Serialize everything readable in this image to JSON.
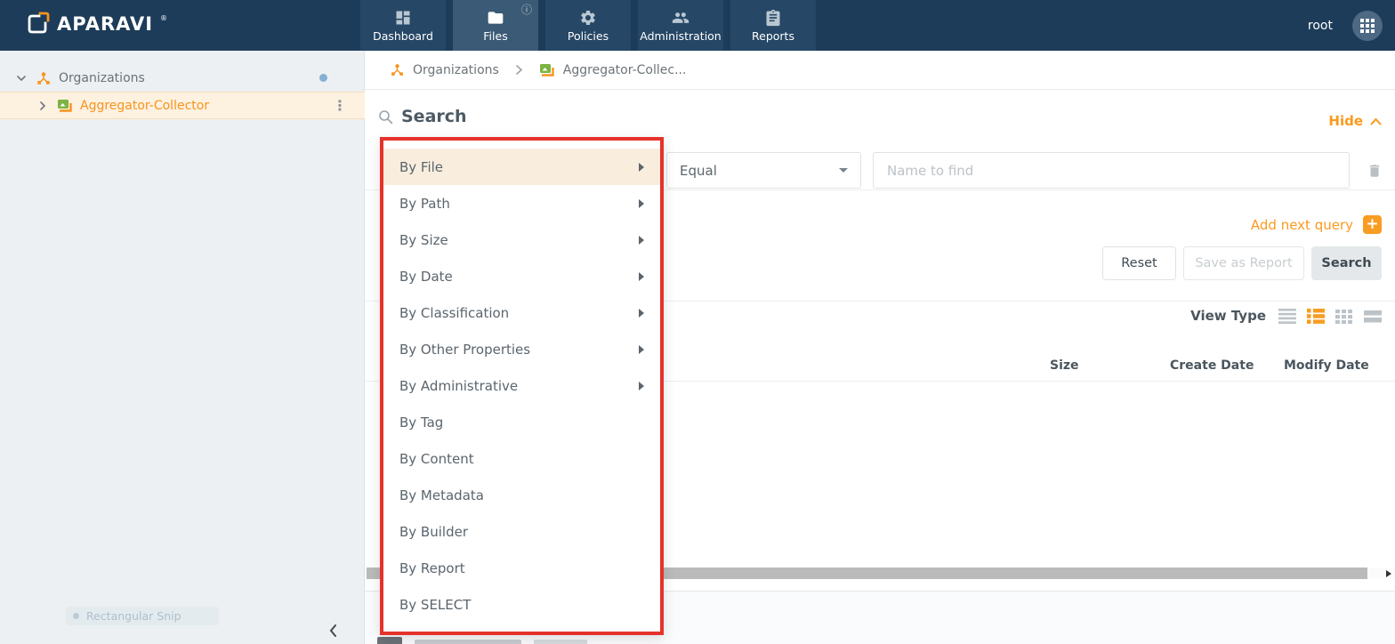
{
  "navbar": {
    "brand": "APARAVI",
    "brand_mark": "®",
    "user": "root",
    "tabs": [
      {
        "label": "Dashboard",
        "icon": "dashboard-icon"
      },
      {
        "label": "Files",
        "icon": "folder-icon"
      },
      {
        "label": "Policies",
        "icon": "gear-icon"
      },
      {
        "label": "Administration",
        "icon": "people-icon"
      },
      {
        "label": "Reports",
        "icon": "clipboard-icon"
      }
    ],
    "active_tab": "Files"
  },
  "sidebar": {
    "root_item": {
      "label": "Organizations",
      "expanded": true
    },
    "child_item": {
      "label": "Aggregator-Collector",
      "selected": true
    },
    "snip_ghost": "Rectangular Snip"
  },
  "breadcrumb": {
    "items": [
      {
        "label": "Organizations",
        "icon": "organizations-icon"
      },
      {
        "label": "Aggregator-Collec...",
        "icon": "collector-icon"
      }
    ]
  },
  "search_panel": {
    "title": "Search",
    "hide_label": "Hide",
    "operator_value": "Equal",
    "name_placeholder": "Name to find",
    "add_next_query_label": "Add next query",
    "plus_label": "+",
    "reset_label": "Reset",
    "save_as_report_label": "Save as Report",
    "search_label": "Search"
  },
  "field_menu": {
    "items": [
      {
        "label": "By File",
        "has_submenu": true,
        "highlighted": true
      },
      {
        "label": "By Path",
        "has_submenu": true
      },
      {
        "label": "By Size",
        "has_submenu": true
      },
      {
        "label": "By Date",
        "has_submenu": true
      },
      {
        "label": "By Classification",
        "has_submenu": true
      },
      {
        "label": "By Other Properties",
        "has_submenu": true
      },
      {
        "label": "By Administrative",
        "has_submenu": true
      },
      {
        "label": "By Tag",
        "has_submenu": false
      },
      {
        "label": "By Content",
        "has_submenu": false
      },
      {
        "label": "By Metadata",
        "has_submenu": false
      },
      {
        "label": "By Builder",
        "has_submenu": false
      },
      {
        "label": "By Report",
        "has_submenu": false
      },
      {
        "label": "By SELECT",
        "has_submenu": false
      }
    ]
  },
  "results": {
    "view_type_label": "View Type",
    "active_view": "detail-list",
    "columns": [
      {
        "label": "Size"
      },
      {
        "label": "Create Date"
      },
      {
        "label": "Modify Date"
      }
    ]
  },
  "colors": {
    "accent_orange": "#f7941d",
    "navbar_blue": "#1d3c59",
    "highlight_cream": "#f9eedd",
    "snip_border_red": "#e5322b",
    "selected_row_bg": "#fdf1e0"
  }
}
